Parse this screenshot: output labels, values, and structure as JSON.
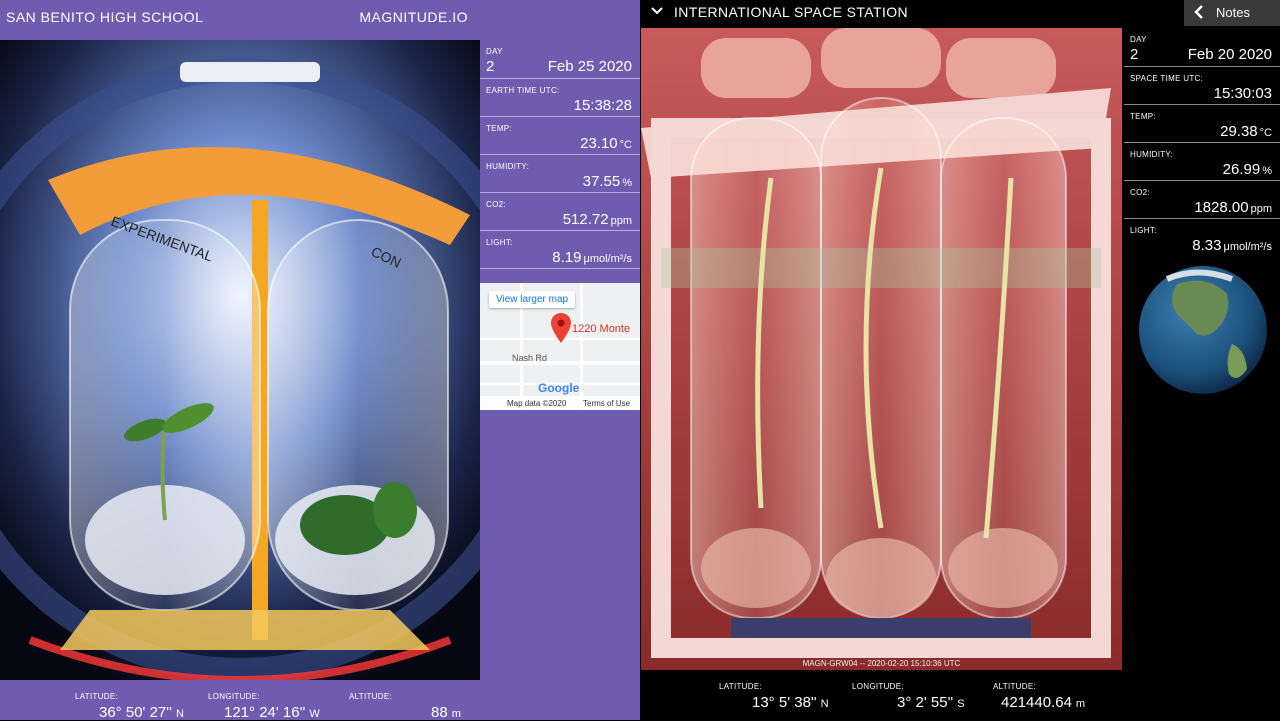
{
  "left_panel": {
    "school": "SAN BENITO HIGH SCHOOL",
    "brand": "MAGNITUDE.IO",
    "camera_labels": {
      "experimental": "EXPERIMENTAL",
      "control": "CON"
    },
    "stats": {
      "day_label": "DAY",
      "day_value": "2",
      "date": "Feb 25 2020",
      "time_label": "EARTH TIME UTC:",
      "time_value": "15:38:28",
      "temp_label": "TEMP:",
      "temp_value": "23.10",
      "temp_unit": "°C",
      "humidity_label": "HUMIDITY:",
      "humidity_value": "37.55",
      "humidity_unit": "%",
      "co2_label": "CO2:",
      "co2_value": "512.72",
      "co2_unit": "ppm",
      "light_label": "LIGHT:",
      "light_value": "8.19",
      "light_unit": "μmol/m²/s"
    },
    "map": {
      "button": "View larger map",
      "address": "1220 Monte",
      "street": "Nash Rd",
      "logo": "Google",
      "data": "Map data ©2020",
      "terms": "Terms of Use"
    },
    "location": {
      "latitude_label": "LATITUDE:",
      "latitude_value": "36° 50' 27''",
      "latitude_dir": "N",
      "longitude_label": "LONGITUDE:",
      "longitude_value": "121° 24' 16''",
      "longitude_dir": "W",
      "altitude_label": "ALTITUDE:",
      "altitude_value": "88",
      "altitude_unit": "m"
    }
  },
  "right_panel": {
    "title": "INTERNATIONAL SPACE STATION",
    "notes_button": "Notes",
    "caption": "MAGN-GRW04 -- 2020-02-20 15:10:36 UTC",
    "stats": {
      "day_label": "DAY",
      "day_value": "2",
      "date": "Feb 20 2020",
      "time_label": "SPACE TIME UTC:",
      "time_value": "15:30:03",
      "temp_label": "TEMP:",
      "temp_value": "29.38",
      "temp_unit": "°C",
      "humidity_label": "HUMIDITY:",
      "humidity_value": "26.99",
      "humidity_unit": "%",
      "co2_label": "CO2:",
      "co2_value": "1828.00",
      "co2_unit": "ppm",
      "light_label": "LIGHT:",
      "light_value": "8.33",
      "light_unit": "μmol/m²/s"
    },
    "location": {
      "latitude_label": "LATITUDE:",
      "latitude_value": "13° 5' 38''",
      "latitude_dir": "N",
      "longitude_label": "LONGITUDE:",
      "longitude_value": "3° 2' 55''",
      "longitude_dir": "S",
      "altitude_label": "ALTITUDE:",
      "altitude_value": "421440.64",
      "altitude_unit": "m"
    }
  },
  "colors": {
    "left_bg": "#6f5bb0",
    "right_bg": "#000000",
    "accent_orange": "#f5a623"
  }
}
